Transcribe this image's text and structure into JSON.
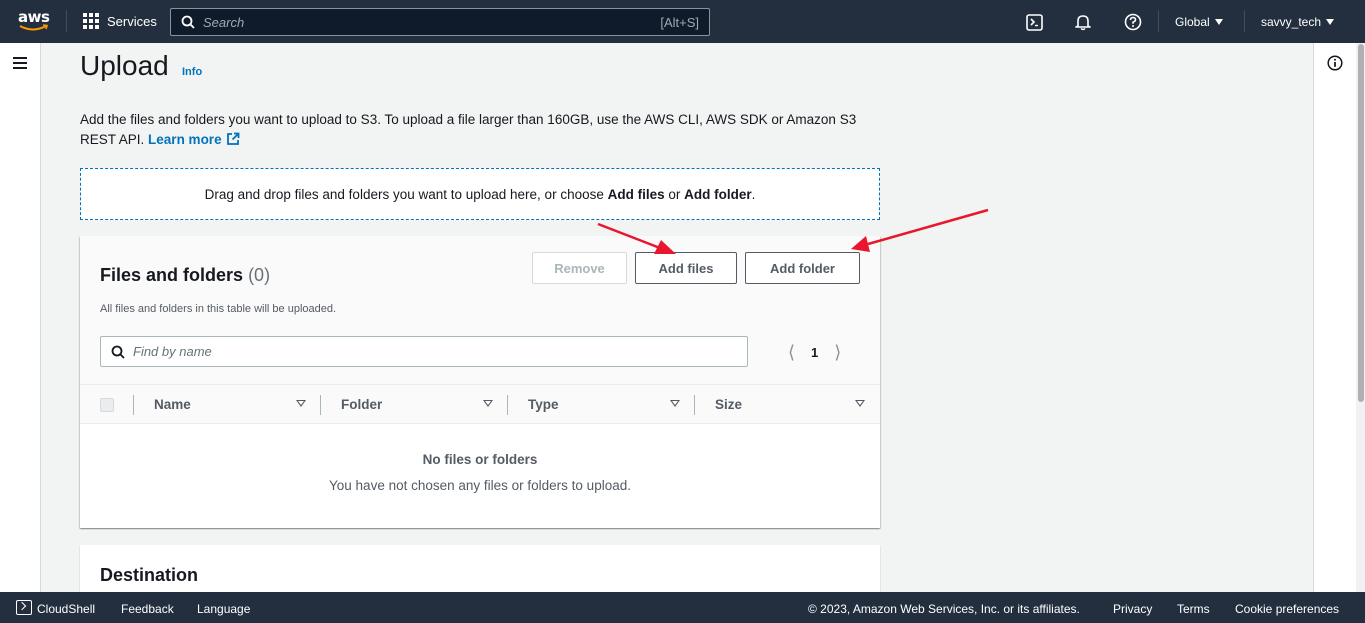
{
  "nav": {
    "logo_text": "aws",
    "services_label": "Services",
    "search_placeholder": "Search",
    "search_shortcut": "[Alt+S]",
    "region_label": "Global",
    "account_label": "savvy_tech"
  },
  "page": {
    "title": "Upload",
    "info_label": "Info",
    "description": "Add the files and folders you want to upload to S3. To upload a file larger than 160GB, use the AWS CLI, AWS SDK or Amazon S3 REST API.",
    "learn_more_label": "Learn more",
    "dropzone_prefix": "Drag and drop files and folders you want to upload here, or choose ",
    "dropzone_add_files": "Add files",
    "dropzone_or": " or ",
    "dropzone_add_folder": "Add folder",
    "dropzone_suffix": "."
  },
  "files_panel": {
    "title": "Files and folders",
    "count": "(0)",
    "subtitle": "All files and folders in this table will be uploaded.",
    "remove_label": "Remove",
    "add_files_label": "Add files",
    "add_folder_label": "Add folder",
    "find_placeholder": "Find by name",
    "current_page": "1",
    "columns": [
      "Name",
      "Folder",
      "Type",
      "Size"
    ],
    "empty_title": "No files or folders",
    "empty_subtitle": "You have not chosen any files or folders to upload."
  },
  "destination": {
    "title": "Destination"
  },
  "footer": {
    "cloudshell_label": "CloudShell",
    "feedback_label": "Feedback",
    "language_label": "Language",
    "copyright": "© 2023, Amazon Web Services, Inc. or its affiliates.",
    "privacy_label": "Privacy",
    "terms_label": "Terms",
    "cookie_label": "Cookie preferences"
  },
  "colors": {
    "nav_bg": "#232f3e",
    "link": "#0073bb",
    "annotation_arrow": "#e8172d"
  }
}
